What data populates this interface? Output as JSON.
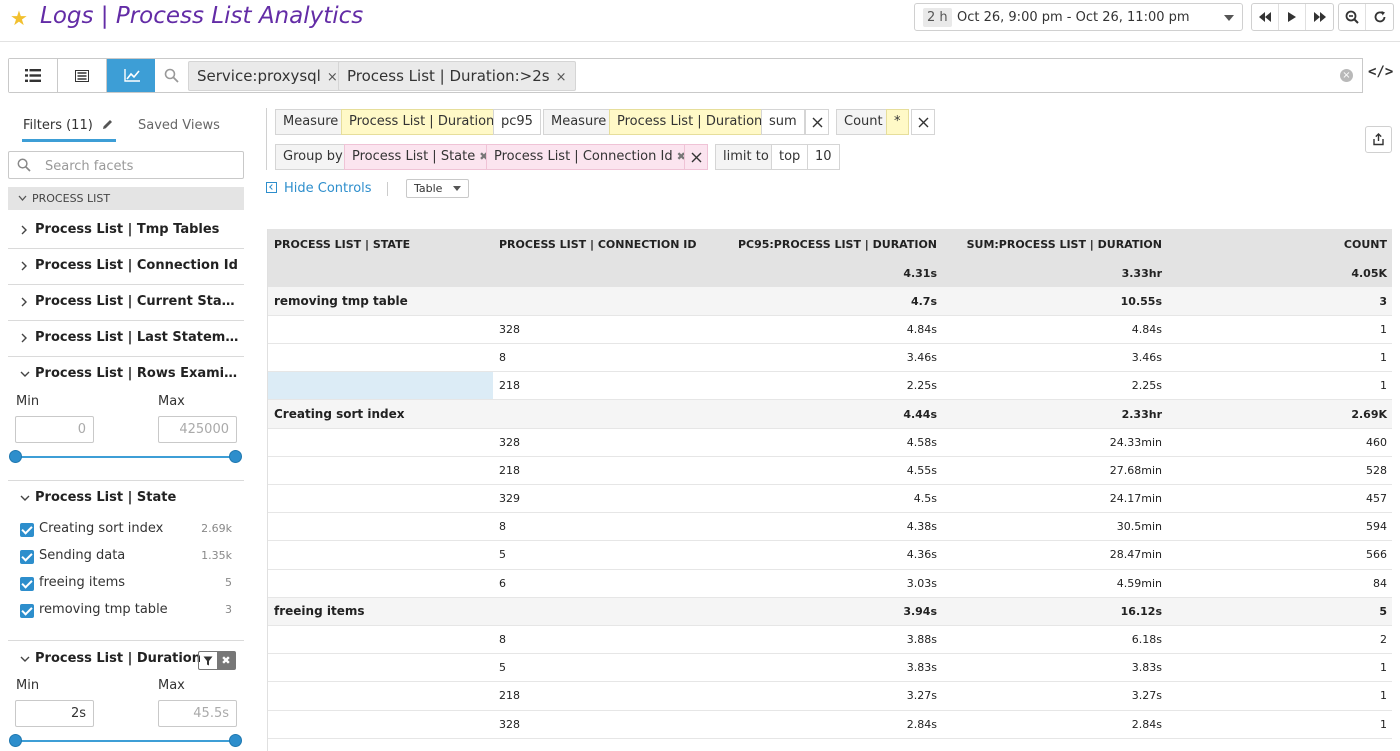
{
  "header": {
    "title": "Logs | Process List Analytics",
    "time_badge": "2 h",
    "time_range": "Oct 26, 9:00 pm - Oct 26, 11:00 pm"
  },
  "search": {
    "pills": [
      "Service:proxysql",
      "Process List | Duration:>2s"
    ],
    "pill_close": "×",
    "clear": "×",
    "code_toggle": "</>"
  },
  "sidebar": {
    "tabs": [
      "Filters (11)",
      "Saved Views"
    ],
    "facet_search_placeholder": "Search facets",
    "section": "PROCESS LIST",
    "facets": [
      "Process List | Tmp Tables",
      "Process List | Connection Id",
      "Process List | Current Statem…",
      "Process List | Last Statement",
      "Process List | Rows Examined",
      "Process List | State",
      "Process List | Duration"
    ],
    "rows_examined": {
      "min_label": "Min",
      "max_label": "Max",
      "min": "0",
      "max": "425000"
    },
    "state_values": [
      {
        "label": "Creating sort index",
        "count": "2.69k"
      },
      {
        "label": "Sending data",
        "count": "1.35k"
      },
      {
        "label": "freeing items",
        "count": "5"
      },
      {
        "label": "removing tmp table",
        "count": "3"
      }
    ],
    "duration": {
      "min_label": "Min",
      "max_label": "Max",
      "min": "2s",
      "max": "45.5s"
    }
  },
  "controls": {
    "measure_label": "Measure",
    "measure1_field": "Process List | Duration",
    "measure1_agg": "pc95",
    "measure2_field": "Process List | Duration",
    "measure2_agg": "sum",
    "count_label": "Count",
    "count_field": "*",
    "group_by_label": "Group by",
    "group1": "Process List | State",
    "group2": "Process List | Connection Id",
    "tag_x": "✖",
    "limit_label": "limit to",
    "limit_dir": "top",
    "limit_n": "10",
    "hide_controls": "Hide Controls",
    "viz_type": "Table"
  },
  "table": {
    "columns": [
      "PROCESS LIST | STATE",
      "PROCESS LIST | CONNECTION ID",
      "PC95:PROCESS LIST | DURATION",
      "SUM:PROCESS LIST | DURATION",
      "COUNT"
    ],
    "totals": [
      "",
      "",
      "4.31s",
      "3.33hr",
      "4.05K"
    ],
    "rows": [
      [
        "removing tmp table",
        "",
        "4.7s",
        "10.55s",
        "3"
      ],
      [
        "",
        "328",
        "4.84s",
        "4.84s",
        "1"
      ],
      [
        "",
        "8",
        "3.46s",
        "3.46s",
        "1"
      ],
      [
        "",
        "218",
        "2.25s",
        "2.25s",
        "1"
      ],
      [
        "Creating sort index",
        "",
        "4.44s",
        "2.33hr",
        "2.69K"
      ],
      [
        "",
        "328",
        "4.58s",
        "24.33min",
        "460"
      ],
      [
        "",
        "218",
        "4.55s",
        "27.68min",
        "528"
      ],
      [
        "",
        "329",
        "4.5s",
        "24.17min",
        "457"
      ],
      [
        "",
        "8",
        "4.38s",
        "30.5min",
        "594"
      ],
      [
        "",
        "5",
        "4.36s",
        "28.47min",
        "566"
      ],
      [
        "",
        "6",
        "3.03s",
        "4.59min",
        "84"
      ],
      [
        "freeing items",
        "",
        "3.94s",
        "16.12s",
        "5"
      ],
      [
        "",
        "8",
        "3.88s",
        "6.18s",
        "2"
      ],
      [
        "",
        "5",
        "3.83s",
        "3.83s",
        "1"
      ],
      [
        "",
        "218",
        "3.27s",
        "3.27s",
        "1"
      ],
      [
        "",
        "328",
        "2.84s",
        "2.84s",
        "1"
      ]
    ]
  }
}
